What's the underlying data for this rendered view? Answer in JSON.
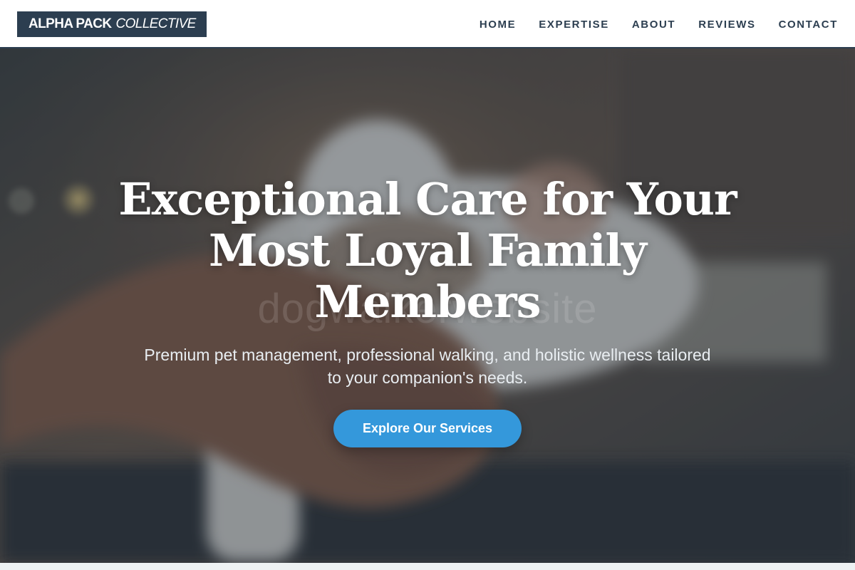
{
  "brand": {
    "name_strong": "ALPHA PACK",
    "name_light": "COLLECTIVE"
  },
  "nav": {
    "items": [
      {
        "label": "HOME"
      },
      {
        "label": "EXPERTISE"
      },
      {
        "label": "ABOUT"
      },
      {
        "label": "REVIEWS"
      },
      {
        "label": "CONTACT"
      }
    ]
  },
  "hero": {
    "background_alt": "dogwalkerwebsite",
    "headline": "Exceptional Care for Your Most Loyal Family Members",
    "subheadline": "Premium pet management, professional walking, and holistic wellness tailored to your companion's needs.",
    "cta_label": "Explore Our Services"
  },
  "colors": {
    "brand_dark": "#2c3e50",
    "accent_blue": "#3498db",
    "header_bg": "#ffffff"
  }
}
